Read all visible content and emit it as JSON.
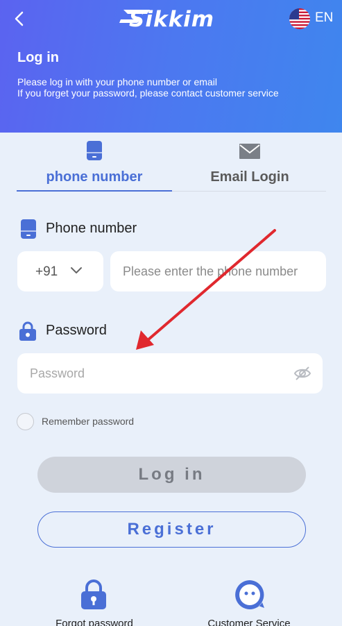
{
  "header": {
    "brand": "Sikkim",
    "language": "EN",
    "title": "Log in",
    "subtitle_line1": "Please log in with your phone number or email",
    "subtitle_line2": "If you forget your password, please contact customer service"
  },
  "tabs": [
    {
      "label": "phone number",
      "icon": "phone-icon",
      "active": true
    },
    {
      "label": "Email Login",
      "icon": "envelope-icon",
      "active": false
    }
  ],
  "form": {
    "phone_label": "Phone number",
    "country_code": "+91",
    "phone_placeholder": "Please enter the phone number",
    "password_label": "Password",
    "password_placeholder": "Password",
    "remember_label": "Remember password"
  },
  "buttons": {
    "login": "Log in",
    "register": "Register"
  },
  "bottom": {
    "forgot": "Forgot password",
    "service": "Customer Service"
  },
  "colors": {
    "accent": "#4a6fd6",
    "header_gradient_start": "#5b63f0",
    "header_gradient_end": "#3f86ee",
    "background": "#e9f0fa",
    "annotation_arrow": "#e0282e"
  }
}
